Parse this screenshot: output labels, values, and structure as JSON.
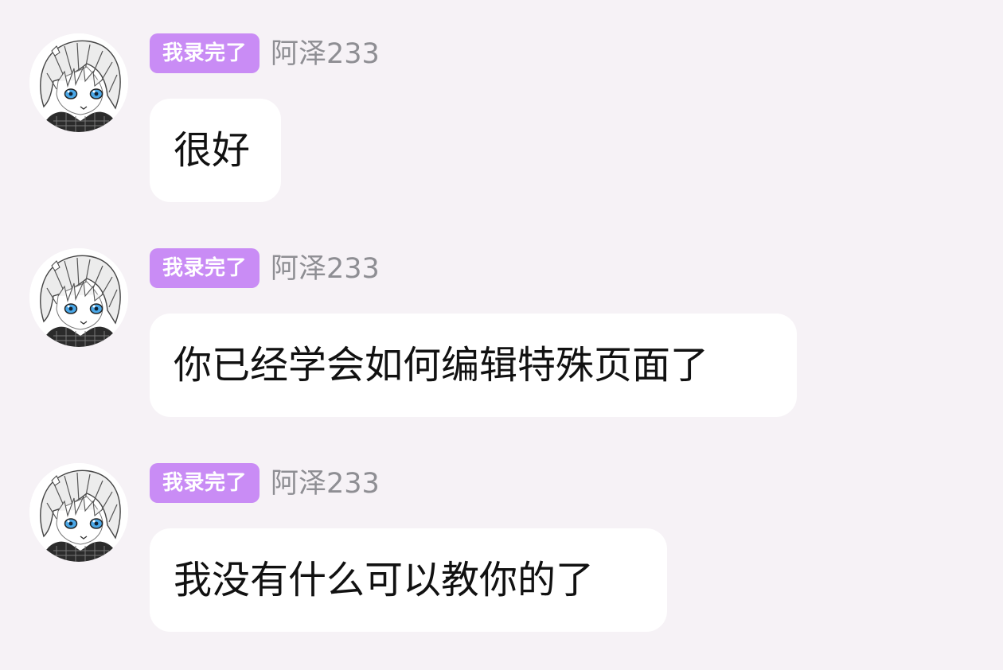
{
  "colors": {
    "background": "#f6f2f6",
    "badge": "#c98cf5",
    "username": "#8e8e93",
    "bubble": "#ffffff",
    "message_text": "#111111"
  },
  "messages": [
    {
      "avatar_icon": "anime-avatar-icon",
      "badge": "我录完了",
      "username": "阿泽233",
      "text": "很好"
    },
    {
      "avatar_icon": "anime-avatar-icon",
      "badge": "我录完了",
      "username": "阿泽233",
      "text": "你已经学会如何编辑特殊页面了"
    },
    {
      "avatar_icon": "anime-avatar-icon",
      "badge": "我录完了",
      "username": "阿泽233",
      "text": "我没有什么可以教你的了"
    }
  ]
}
